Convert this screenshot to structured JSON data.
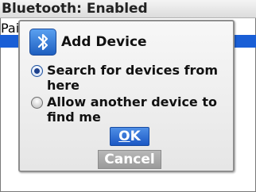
{
  "screen": {
    "title": "Bluetooth: Enabled",
    "list_item_partial": "Pai"
  },
  "dialog": {
    "title": "Add Device",
    "icon": "bluetooth-icon",
    "options": [
      {
        "label": "Search for devices from here",
        "selected": true
      },
      {
        "label": "Allow another device to find me",
        "selected": false
      }
    ],
    "ok_first": "O",
    "ok_rest": "K",
    "cancel_label": "Cancel"
  },
  "colors": {
    "accent": "#1b57c4",
    "selection_bar": "#1a5fd6"
  }
}
